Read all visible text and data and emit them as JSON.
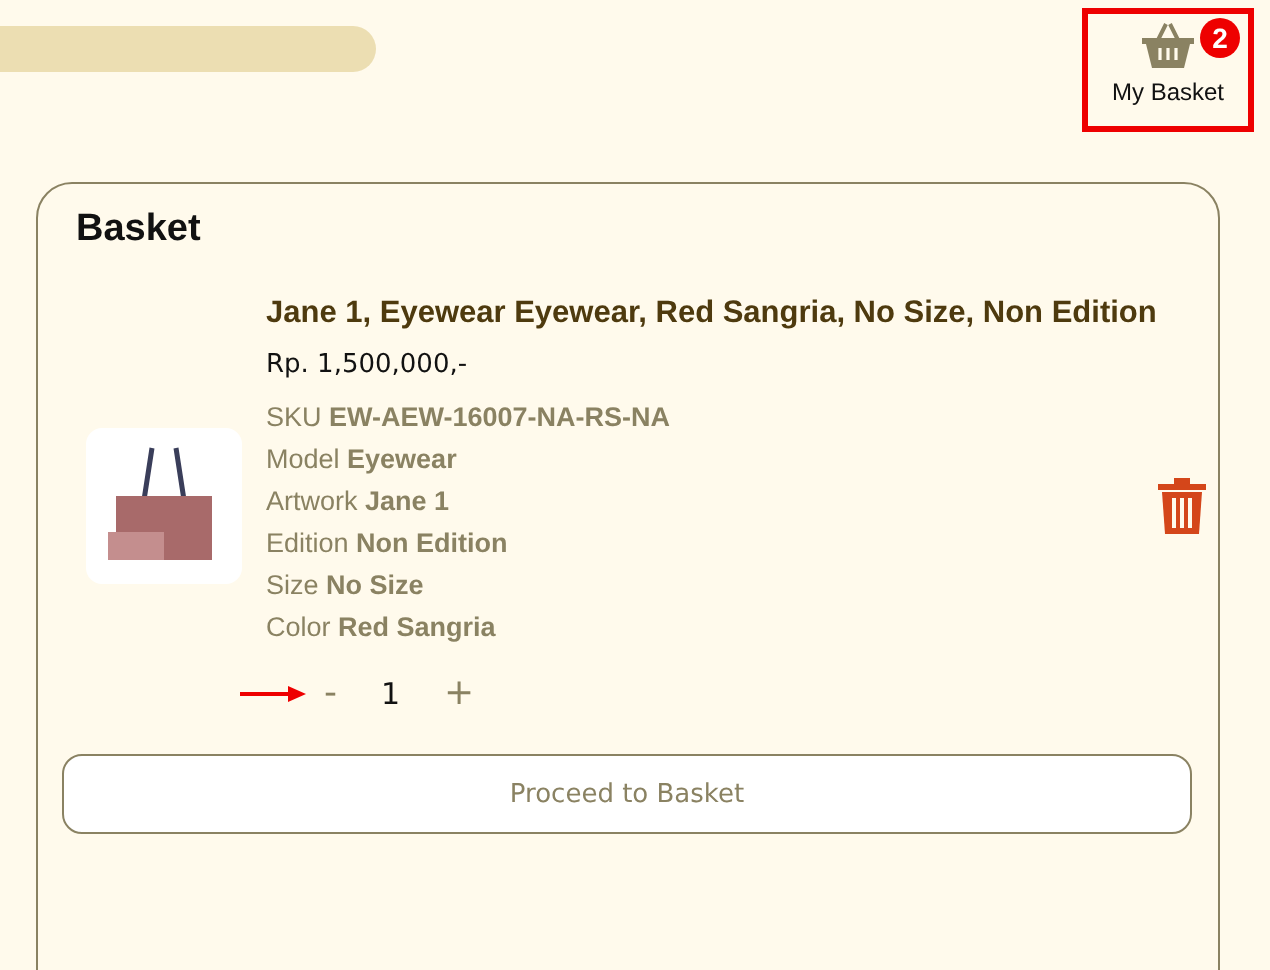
{
  "header": {
    "basket": {
      "label": "My Basket",
      "count": "2"
    }
  },
  "basket": {
    "title": "Basket",
    "items": [
      {
        "name": "Jane 1, Eyewear Eyewear, Red Sangria, No Size, Non Edition",
        "price": "Rp. 1,500,000,-",
        "attributes": [
          "SKU **EW-AEW-16007-NA-RS-NA**",
          "Model **Eyewear**",
          "Artwork **Jane 1**",
          "Edition **Non Edition**",
          "Size **No Size**",
          "Color **Red Sangria**"
        ],
        "quantity": {
          "minus": "-",
          "value": "1",
          "plus": "+"
        }
      }
    ],
    "button": "Proceed to Basket"
  }
}
